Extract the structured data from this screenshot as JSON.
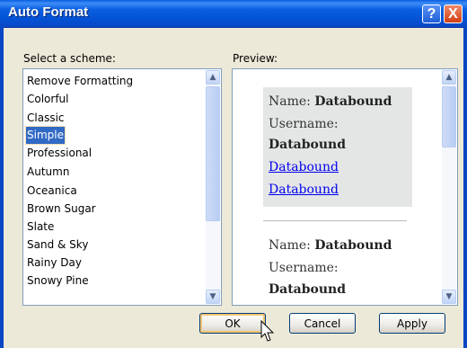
{
  "window": {
    "title": "Auto Format"
  },
  "labels": {
    "select_scheme": "Select a scheme:",
    "preview": "Preview:"
  },
  "schemes": {
    "items": [
      "Remove Formatting",
      "Colorful",
      "Classic",
      "Simple",
      "Professional",
      "Autumn",
      "Oceanica",
      "Brown Sugar",
      "Slate",
      "Sand & Sky",
      "Rainy Day",
      "Snowy Pine"
    ],
    "selected": "Simple"
  },
  "preview": {
    "record1": {
      "name_label": "Name:",
      "name_value": "Databound",
      "username_label": "Username:",
      "username_value": "Databound",
      "link1": "Databound",
      "link2": "Databound"
    },
    "record2": {
      "name_label": "Name:",
      "name_value": "Databound",
      "username_label": "Username:",
      "username_value": "Databound"
    }
  },
  "buttons": {
    "ok": "OK",
    "cancel": "Cancel",
    "apply": "Apply"
  },
  "icons": {
    "help": "?",
    "close": "X",
    "scroll_up": "▲",
    "scroll_down": "▼"
  },
  "colors": {
    "titlebar": "#0a5fe0",
    "selection": "#316ac5",
    "dialog_bg": "#ece9d8",
    "link": "#0000ee"
  }
}
